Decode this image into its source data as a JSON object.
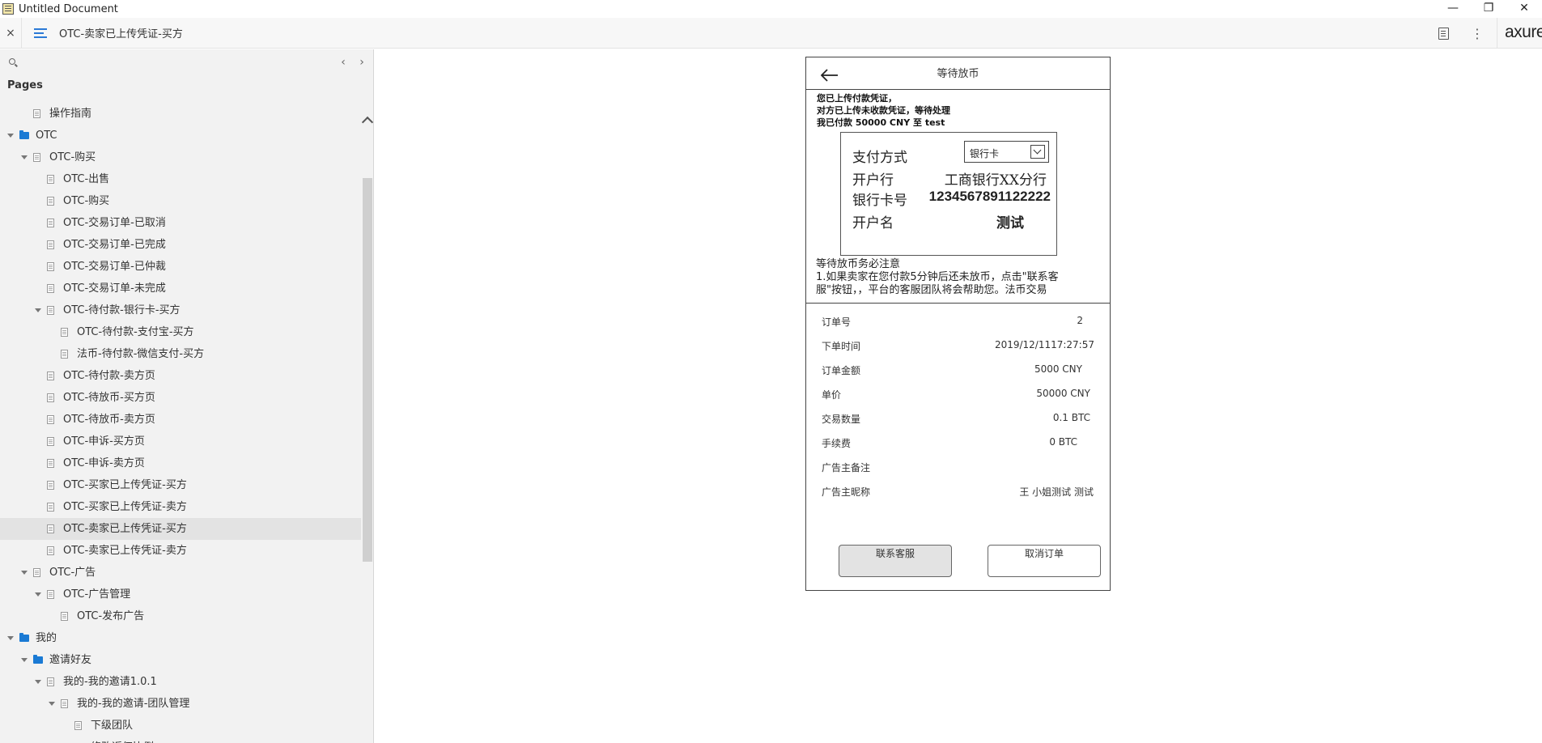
{
  "window": {
    "title": "Untitled Document",
    "controls": [
      "—",
      "❐",
      "✕"
    ]
  },
  "toolbar": {
    "close": "×",
    "page_title": "OTC-卖家已上传凭证-买方",
    "brand": "axure"
  },
  "sidebar": {
    "search_placeholder": "",
    "nav_prev": "‹",
    "nav_next": "›",
    "pages_label": "Pages",
    "items": [
      {
        "label": "操作指南",
        "type": "page",
        "level": 1
      },
      {
        "label": "OTC",
        "type": "folder",
        "level": 0,
        "expanded": true
      },
      {
        "label": "OTC-购买",
        "type": "page",
        "level": 1,
        "expanded": true
      },
      {
        "label": "OTC-出售",
        "type": "page",
        "level": 2
      },
      {
        "label": "OTC-购买",
        "type": "page",
        "level": 2
      },
      {
        "label": "OTC-交易订单-已取消",
        "type": "page",
        "level": 2
      },
      {
        "label": "OTC-交易订单-已完成",
        "type": "page",
        "level": 2
      },
      {
        "label": "OTC-交易订单-已仲裁",
        "type": "page",
        "level": 2
      },
      {
        "label": "OTC-交易订单-未完成",
        "type": "page",
        "level": 2
      },
      {
        "label": "OTC-待付款-银行卡-买方",
        "type": "page",
        "level": 2,
        "expanded": true
      },
      {
        "label": "OTC-待付款-支付宝-买方",
        "type": "page",
        "level": 3
      },
      {
        "label": "法币-待付款-微信支付-买方",
        "type": "page",
        "level": 3
      },
      {
        "label": "OTC-待付款-卖方页",
        "type": "page",
        "level": 2
      },
      {
        "label": "OTC-待放币-买方页",
        "type": "page",
        "level": 2
      },
      {
        "label": "OTC-待放币-卖方页",
        "type": "page",
        "level": 2
      },
      {
        "label": "OTC-申诉-买方页",
        "type": "page",
        "level": 2
      },
      {
        "label": "OTC-申诉-卖方页",
        "type": "page",
        "level": 2
      },
      {
        "label": "OTC-买家已上传凭证-买方",
        "type": "page",
        "level": 2
      },
      {
        "label": "OTC-买家已上传凭证-卖方",
        "type": "page",
        "level": 2
      },
      {
        "label": "OTC-卖家已上传凭证-买方",
        "type": "page",
        "level": 2,
        "selected": true
      },
      {
        "label": "OTC-卖家已上传凭证-卖方",
        "type": "page",
        "level": 2
      },
      {
        "label": "OTC-广告",
        "type": "page",
        "level": 1,
        "expanded": true
      },
      {
        "label": "OTC-广告管理",
        "type": "page",
        "level": 2,
        "expanded": true
      },
      {
        "label": "OTC-发布广告",
        "type": "page",
        "level": 3
      },
      {
        "label": "我的",
        "type": "folder",
        "level": 0,
        "expanded": true
      },
      {
        "label": "邀请好友",
        "type": "folder",
        "level": 1,
        "expanded": true
      },
      {
        "label": "我的-我的邀请1.0.1",
        "type": "page",
        "level": 2,
        "expanded": true
      },
      {
        "label": "我的-我的邀请-团队管理",
        "type": "page",
        "level": 3,
        "expanded": true
      },
      {
        "label": "下级团队",
        "type": "page",
        "level": 4
      },
      {
        "label": "修改返佣比例",
        "type": "page",
        "level": 4
      }
    ]
  },
  "phone": {
    "title": "等待放币",
    "notice": [
      "您已上传付款凭证，",
      "对方已上传未收款凭证，等待处理",
      "我已付款 50000 CNY 至 test"
    ],
    "payment": {
      "method_label": "支付方式",
      "method_value": "银行卡",
      "bank_label": "开户行",
      "bank_value": "工商银行XX分行",
      "card_label": "银行卡号",
      "card_value": "1234567891122222",
      "name_label": "开户名",
      "name_value": "测试"
    },
    "hint": [
      "等待放币务必注意",
      "1.如果卖家在您付款5分钟后还未放币，点击\"联系客",
      "服\"按钮，，平台的客服团队将会帮助您。法币交易"
    ],
    "details": [
      {
        "label": "订单号",
        "value": "2"
      },
      {
        "label": "下单时间",
        "value": "2019/12/1117:27:57"
      },
      {
        "label": "订单金额",
        "value": "5000 CNY"
      },
      {
        "label": "单价",
        "value": "50000 CNY"
      },
      {
        "label": "交易数量",
        "value": "0.1 BTC"
      },
      {
        "label": "手续费",
        "value": "0 BTC"
      },
      {
        "label": "广告主备注",
        "value": ""
      },
      {
        "label": "广告主昵称",
        "value": "王 小姐测试 测试"
      }
    ],
    "buttons": {
      "contact": "联系客服",
      "cancel": "取消订单"
    }
  }
}
